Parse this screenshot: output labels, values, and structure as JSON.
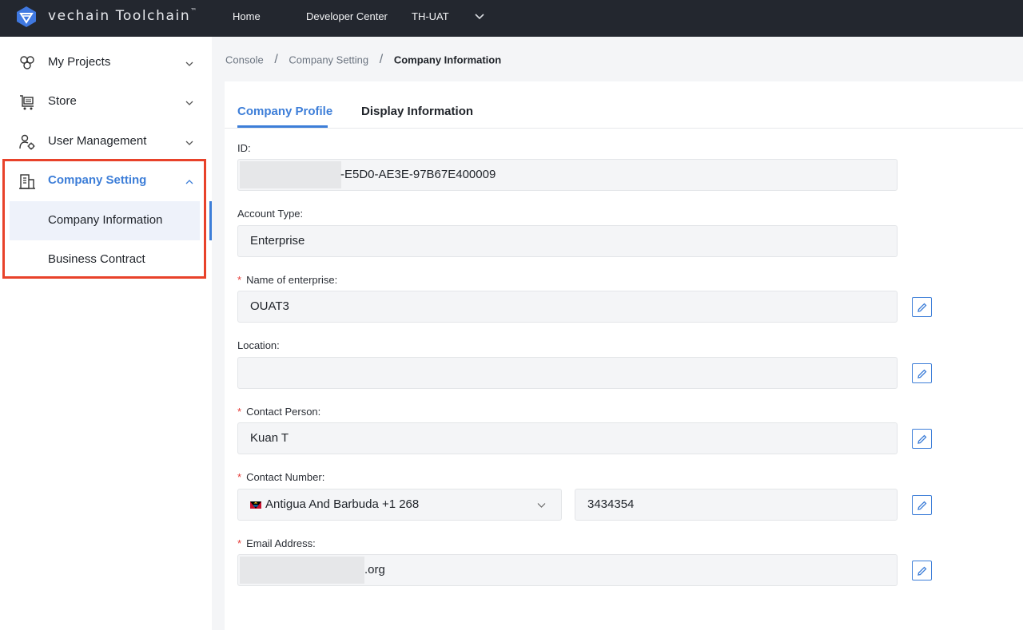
{
  "header": {
    "brand": "vechain Toolchain",
    "brand_tm": "™",
    "nav": {
      "home": "Home",
      "developer_center": "Developer Center",
      "environment": "TH-UAT"
    }
  },
  "sidebar": {
    "items": [
      {
        "label": "My Projects",
        "icon": "projects-icon"
      },
      {
        "label": "Store",
        "icon": "cart-icon"
      },
      {
        "label": "User Management",
        "icon": "user-settings-icon"
      },
      {
        "label": "Company Setting",
        "icon": "building-icon",
        "expanded": true,
        "children": [
          {
            "label": "Company Information",
            "selected": true
          },
          {
            "label": "Business Contract"
          }
        ]
      }
    ]
  },
  "breadcrumb": {
    "items": [
      "Console",
      "Company Setting"
    ],
    "current": "Company Information",
    "separator": "/"
  },
  "tabs": [
    {
      "label": "Company Profile",
      "active": true
    },
    {
      "label": "Display Information"
    }
  ],
  "form": {
    "id": {
      "label": "ID:",
      "value": "-E5D0-AE3E-97B67E400009"
    },
    "account_type": {
      "label": "Account Type:",
      "value": "Enterprise"
    },
    "enterprise_name": {
      "label": "Name of enterprise:",
      "value": "OUAT3",
      "required_mark": "*"
    },
    "location": {
      "label": "Location:",
      "value": ""
    },
    "contact_person": {
      "label": "Contact Person:",
      "value": "Kuan T",
      "required_mark": "*"
    },
    "contact_number": {
      "label": "Contact Number:",
      "country": "Antigua And Barbuda +1 268",
      "value": "3434354",
      "required_mark": "*"
    },
    "email": {
      "label": "Email Address:",
      "value": ".org",
      "required_mark": "*"
    }
  },
  "colors": {
    "accent": "#3d7ed8",
    "topbar": "#23272f",
    "highlight": "#e8422a",
    "required": "#e53935"
  }
}
